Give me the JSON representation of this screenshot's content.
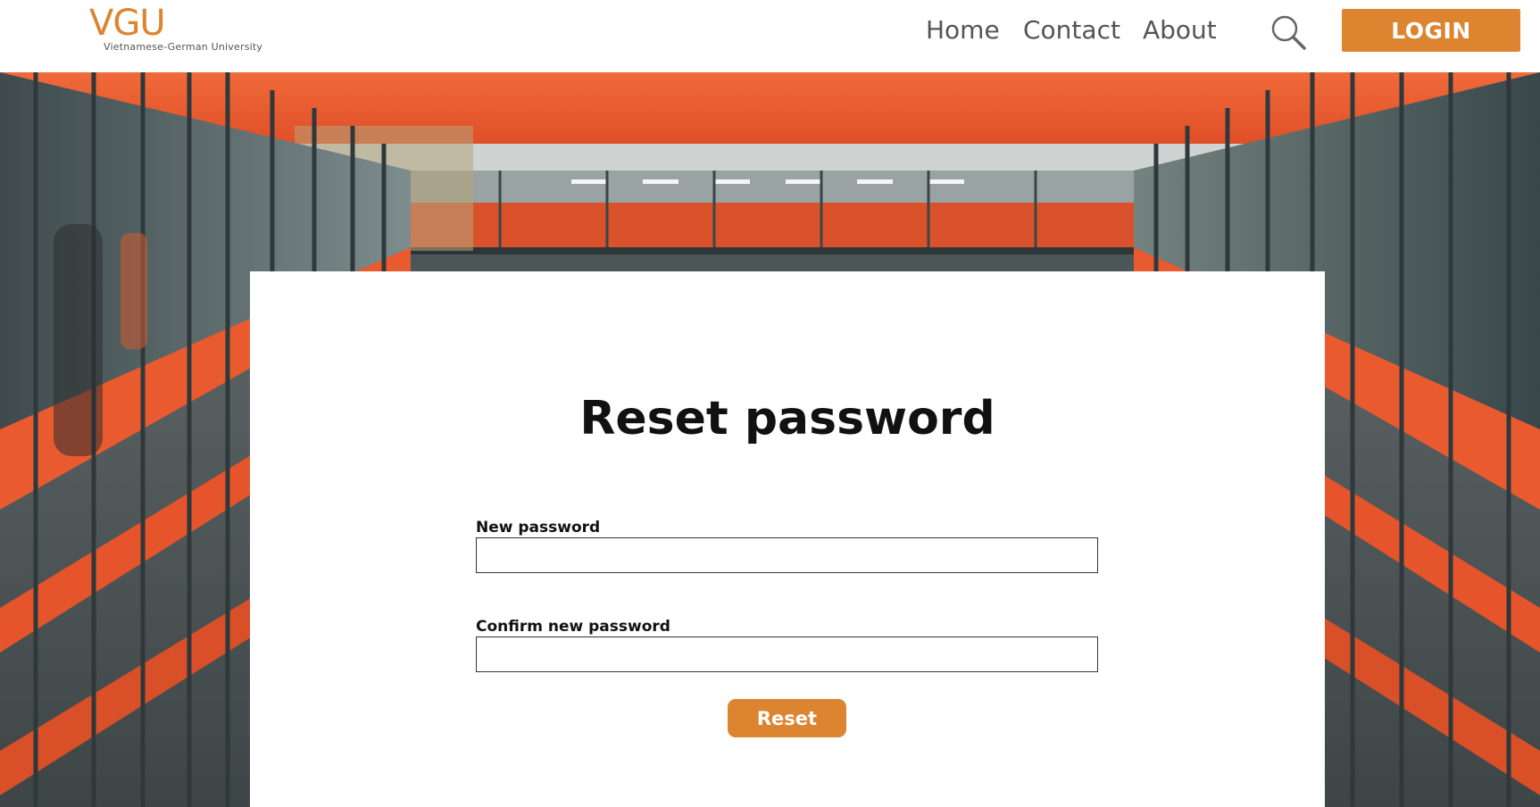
{
  "header": {
    "logo_text": "VGU",
    "logo_subtitle": "Vietnamese-German University",
    "nav": [
      "Home",
      "Contact",
      "About"
    ],
    "search_icon": "search-icon",
    "login_label": "LOGIN"
  },
  "form": {
    "title": "Reset password",
    "new_password_label": "New password",
    "new_password_value": "",
    "confirm_password_label": "Confirm new password",
    "confirm_password_value": "",
    "reset_label": "Reset"
  },
  "colors": {
    "accent": "#dd8431",
    "hero_orange": "#e8572c",
    "text_dark": "#111111",
    "nav_text": "#555555"
  }
}
